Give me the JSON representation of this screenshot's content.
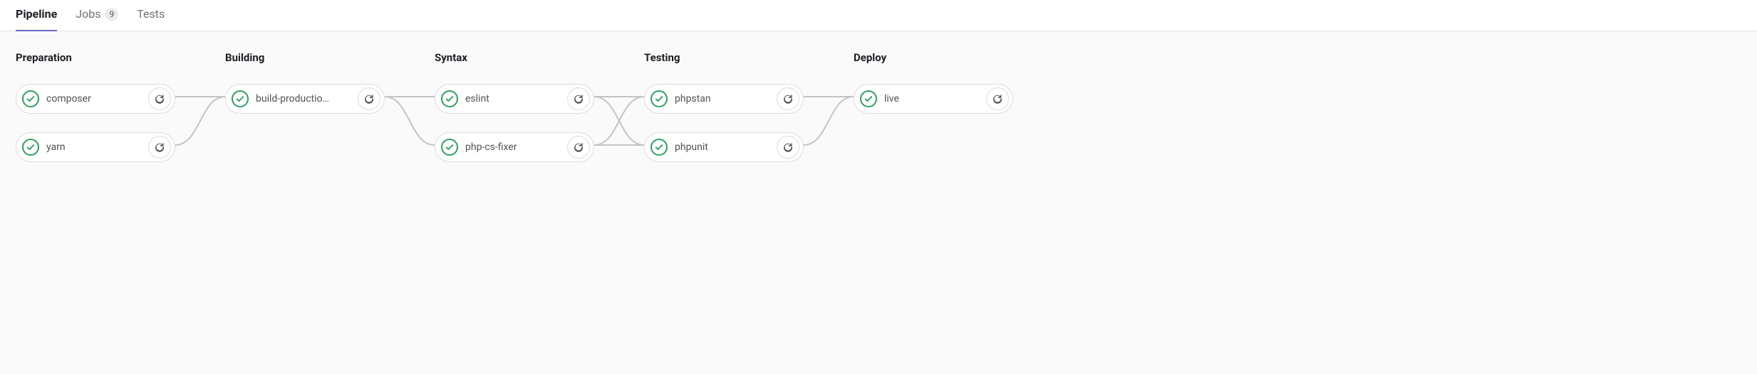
{
  "tabs": [
    {
      "label": "Pipeline",
      "active": true
    },
    {
      "label": "Jobs",
      "badge": "9",
      "active": false
    },
    {
      "label": "Tests",
      "active": false
    }
  ],
  "stages": [
    {
      "name": "Preparation",
      "jobs": [
        {
          "name": "composer",
          "status": "success"
        },
        {
          "name": "yarn",
          "status": "success"
        }
      ]
    },
    {
      "name": "Building",
      "jobs": [
        {
          "name": "build-productio…",
          "status": "success"
        }
      ]
    },
    {
      "name": "Syntax",
      "jobs": [
        {
          "name": "eslint",
          "status": "success"
        },
        {
          "name": "php-cs-fixer",
          "status": "success"
        }
      ]
    },
    {
      "name": "Testing",
      "jobs": [
        {
          "name": "phpstan",
          "status": "success"
        },
        {
          "name": "phpunit",
          "status": "success"
        }
      ]
    },
    {
      "name": "Deploy",
      "jobs": [
        {
          "name": "live",
          "status": "success"
        }
      ]
    }
  ]
}
